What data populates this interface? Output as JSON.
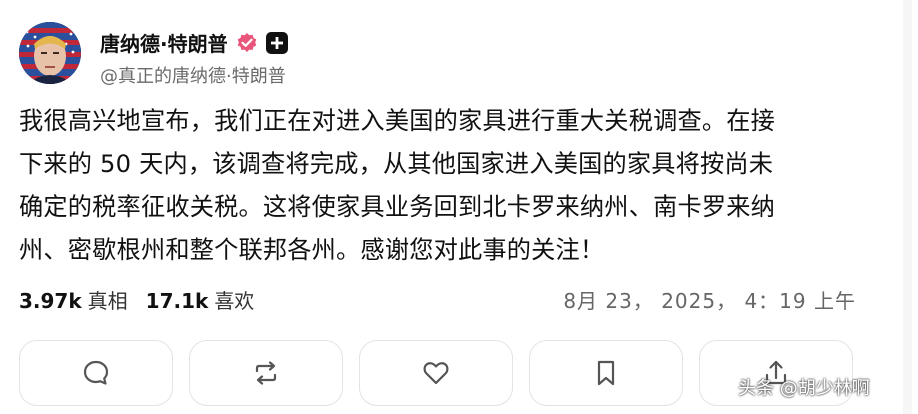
{
  "user": {
    "display_name": "唐纳德·特朗普",
    "handle": "@真正的唐纳德·特朗普"
  },
  "post": {
    "lines": [
      "我很高兴地宣布，我们正在对进入美国的家具进行重大关税调查。在接",
      "下来的 50 天内，该调查将完成，从其他国家进入美国的家具将按尚未",
      "确定的税率征收关税。这将使家具业务回到北卡罗来纳州、南卡罗来纳",
      "州、密歇根州和整个联邦各州。感谢您对此事的关注！"
    ]
  },
  "stats": {
    "reposts_count": "3.97k",
    "reposts_label": "真相",
    "likes_count": "17.1k",
    "likes_label": "喜欢"
  },
  "timestamp": "8月 23， 2025， 4：19 上午",
  "actions": [
    {
      "icon": "reply-icon"
    },
    {
      "icon": "repost-icon"
    },
    {
      "icon": "heart-icon"
    },
    {
      "icon": "bookmark-icon"
    },
    {
      "icon": "share-icon"
    }
  ],
  "watermark": "头条 @胡少林啊",
  "colors": {
    "verified_badge": "#e8567b",
    "text": "#111111",
    "secondary_text": "#6b6b6b",
    "border": "#e3e3e3",
    "icon": "#555555"
  }
}
